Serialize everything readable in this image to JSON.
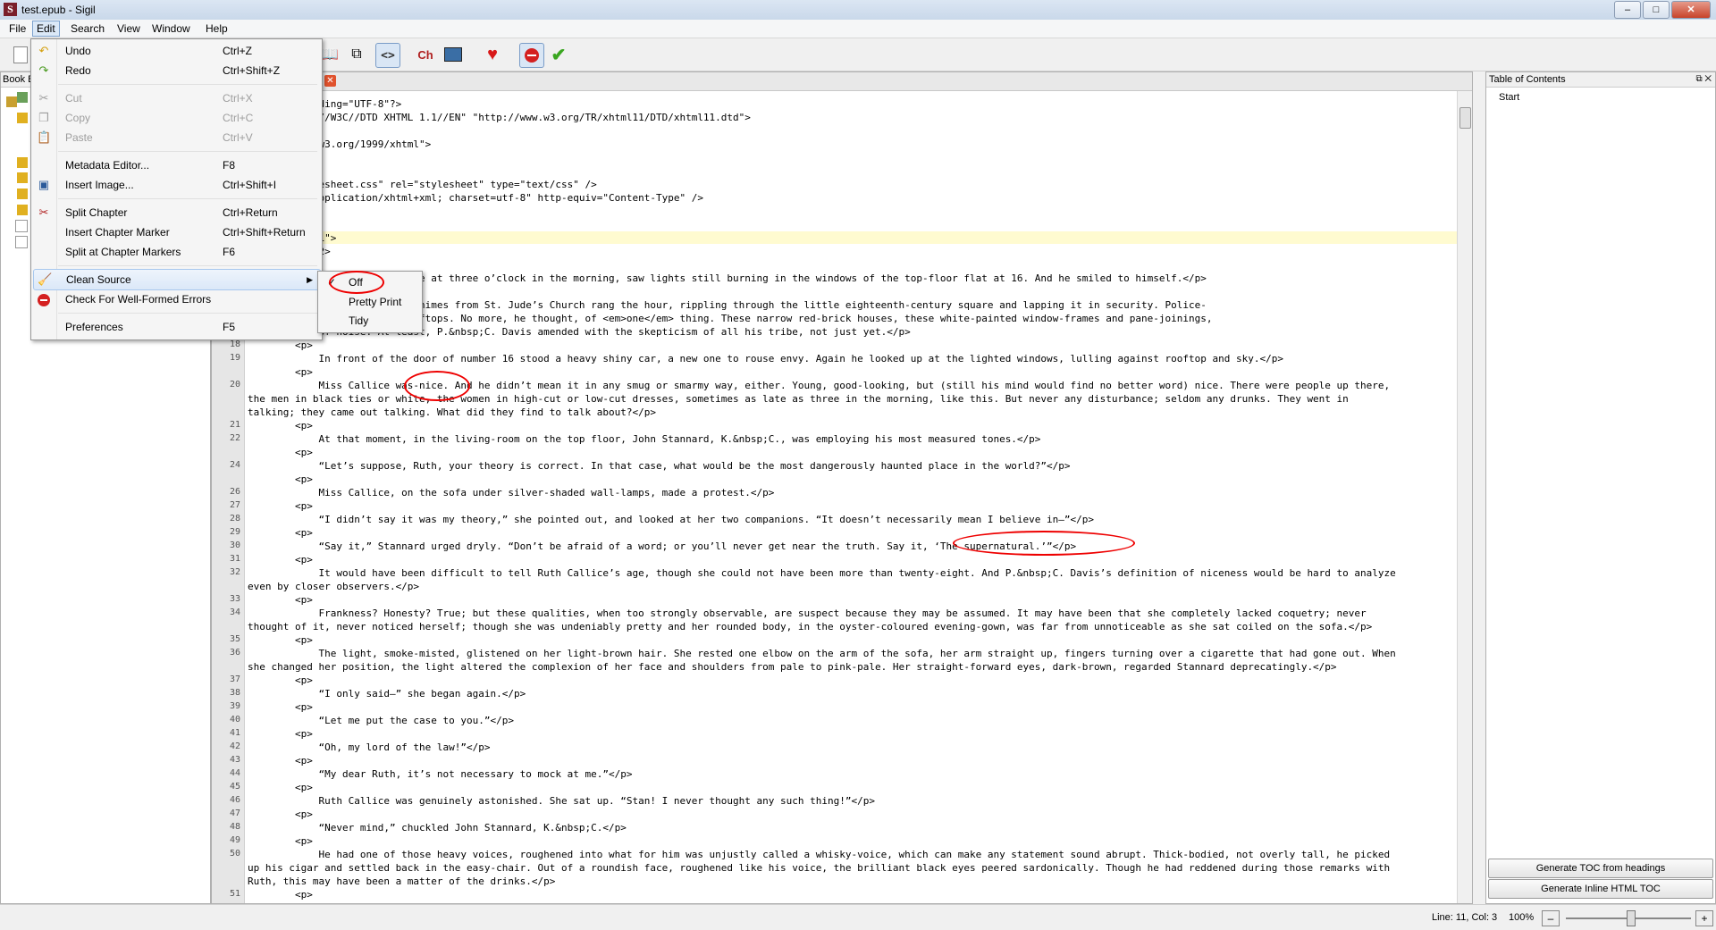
{
  "window": {
    "title": "test.epub - Sigil",
    "app_icon": "S"
  },
  "menubar": [
    "File",
    "Edit",
    "Search",
    "View",
    "Window",
    "Help"
  ],
  "edit_menu": {
    "undo": {
      "label": "Undo",
      "shortcut": "Ctrl+Z"
    },
    "redo": {
      "label": "Redo",
      "shortcut": "Ctrl+Shift+Z"
    },
    "cut": {
      "label": "Cut",
      "shortcut": "Ctrl+X"
    },
    "copy": {
      "label": "Copy",
      "shortcut": "Ctrl+C"
    },
    "paste": {
      "label": "Paste",
      "shortcut": "Ctrl+V"
    },
    "metadata": {
      "label": "Metadata Editor...",
      "shortcut": "F8"
    },
    "insert_image": {
      "label": "Insert Image...",
      "shortcut": "Ctrl+Shift+I"
    },
    "split_chapter": {
      "label": "Split Chapter",
      "shortcut": "Ctrl+Return"
    },
    "insert_marker": {
      "label": "Insert Chapter Marker",
      "shortcut": "Ctrl+Shift+Return"
    },
    "split_markers": {
      "label": "Split at Chapter Markers",
      "shortcut": "F6"
    },
    "clean_source": {
      "label": "Clean Source"
    },
    "check_errors": {
      "label": "Check For Well-Formed Errors"
    },
    "preferences": {
      "label": "Preferences",
      "shortcut": "F5"
    }
  },
  "clean_submenu": {
    "off": "Off",
    "pretty": "Pretty Print",
    "tidy": "Tidy",
    "checked": "✓"
  },
  "book_browser": {
    "title": "Book B"
  },
  "toc_panel": {
    "title": "Table of Contents",
    "items": [
      "Start"
    ],
    "btn_generate": "Generate TOC from headings",
    "btn_inline": "Generate Inline HTML TOC"
  },
  "status": {
    "position": "Line: 11, Col: 3",
    "zoom": "100%"
  },
  "code_lines": [
    {
      "n": "",
      "t": "n=\"1.0\" encoding=\"UTF-8\"?>"
    },
    {
      "n": "",
      "t": "ml PUBLIC \"-//W3C//DTD XHTML 1.1//EN\" \"http://www.w3.org/TR/xhtml11/DTD/xhtml11.dtd\">"
    },
    {
      "n": "",
      "t": ""
    },
    {
      "n": "",
      "t": "\"http://www.w3.org/1999/xhtml\">"
    },
    {
      "n": "",
      "t": ""
    },
    {
      "n": "",
      "t": "le></title>"
    },
    {
      "n": "",
      "t": "k href=\"stylesheet.css\" rel=\"stylesheet\" type=\"text/css\" />"
    },
    {
      "n": "",
      "t": "a content=\"application/xhtml+xml; charset=utf-8\" http-equiv=\"Content-Type\" />"
    },
    {
      "n": "",
      "t": ""
    },
    {
      "n": "",
      "t": ""
    },
    {
      "n": "",
      "t": "id=\"chapter01\">",
      "hl": true
    },
    {
      "n": "",
      "t": "Chapter 1</h2>"
    },
    {
      "n": "",
      "t": ""
    },
    {
      "n": "",
      "t": "assing through Moreston Square at three o’clock in the morning, saw lights still burning in the windows of the top-floor flat at 16. And he smiled to himself.</p>"
    },
    {
      "n": "",
      "t": ""
    },
    {
      "n": "",
      "t": "ss Ruth Callice’s flat. The chimes from St. Jude’s Church rang the hour, rippling through the little eighteenth-century square and lapping it in security. Police-"
    },
    {
      "n": "",
      "t": "t a quarter-moon over the rooftops. No more, he thought, of <em>one</em> thing. These narrow red-brick houses, these white-painted window-frames and pane-joinings,"
    },
    {
      "n": "",
      "t": "a nightmare of noise. At least, P.&nbsp;C. Davis amended with the skepticism of all his tribe, not just yet.</p>"
    },
    {
      "n": "18",
      "t": "        <p>"
    },
    {
      "n": "19",
      "t": "            In front of the door of number 16 stood a heavy shiny car, a new one to rouse envy. Again he looked up at the lighted windows, lulling against rooftop and sky.</p>"
    },
    {
      "n": "",
      "t": "        <p>"
    },
    {
      "n": "20",
      "t": "            Miss Callice was-nice. And he didn’t mean it in any smug or smarmy way, either. Young, good-looking, but (still his mind would find no better word) nice. There were people up there,"
    },
    {
      "n": "",
      "t": "the men in black ties or white, the women in high-cut or low-cut dresses, sometimes as late as three in the morning, like this. But never any disturbance; seldom any drunks. They went in"
    },
    {
      "n": "",
      "t": "talking; they came out talking. What did they find to talk about?</p>"
    },
    {
      "n": "21",
      "t": "        <p>"
    },
    {
      "n": "22",
      "t": "            At that moment, in the living-room on the top floor, John Stannard, K.&nbsp;C., was employing his most measured tones.</p>"
    },
    {
      "n": "",
      "t": "        <p>"
    },
    {
      "n": "24",
      "t": "            “Let’s suppose, Ruth, your theory is correct. In that case, what would be the most dangerously haunted place in the world?”</p>"
    },
    {
      "n": "",
      "t": "        <p>"
    },
    {
      "n": "26",
      "t": "            Miss Callice, on the sofa under silver-shaded wall-lamps, made a protest.</p>"
    },
    {
      "n": "27",
      "t": "        <p>"
    },
    {
      "n": "28",
      "t": "            “I didn’t say it was my theory,” she pointed out, and looked at her two companions. “It doesn’t necessarily mean I believe in—”</p>"
    },
    {
      "n": "29",
      "t": "        <p>"
    },
    {
      "n": "30",
      "t": "            “Say it,” Stannard urged dryly. “Don’t be afraid of a word; or you’ll never get near the truth. Say it, ‘The supernatural.’”</p>"
    },
    {
      "n": "31",
      "t": "        <p>"
    },
    {
      "n": "32",
      "t": "            It would have been difficult to tell Ruth Callice’s age, though she could not have been more than twenty-eight. And P.&nbsp;C. Davis’s definition of niceness would be hard to analyze"
    },
    {
      "n": "",
      "t": "even by closer observers.</p>"
    },
    {
      "n": "33",
      "t": "        <p>"
    },
    {
      "n": "34",
      "t": "            Frankness? Honesty? True; but these qualities, when too strongly observable, are suspect because they may be assumed. It may have been that she completely lacked coquetry; never"
    },
    {
      "n": "",
      "t": "thought of it, never noticed herself; though she was undeniably pretty and her rounded body, in the oyster-coloured evening-gown, was far from unnoticeable as she sat coiled on the sofa.</p>"
    },
    {
      "n": "35",
      "t": "        <p>"
    },
    {
      "n": "36",
      "t": "            The light, smoke-misted, glistened on her light-brown hair. She rested one elbow on the arm of the sofa, her arm straight up, fingers turning over a cigarette that had gone out. When"
    },
    {
      "n": "",
      "t": "she changed her position, the light altered the complexion of her face and shoulders from pale to pink-pale. Her straight-forward eyes, dark-brown, regarded Stannard deprecatingly.</p>"
    },
    {
      "n": "37",
      "t": "        <p>"
    },
    {
      "n": "38",
      "t": "            “I only said—” she began again.</p>"
    },
    {
      "n": "39",
      "t": "        <p>"
    },
    {
      "n": "40",
      "t": "            “Let me put the case to you.”</p>"
    },
    {
      "n": "41",
      "t": "        <p>"
    },
    {
      "n": "42",
      "t": "            “Oh, my lord of the law!”</p>"
    },
    {
      "n": "43",
      "t": "        <p>"
    },
    {
      "n": "44",
      "t": "            “My dear Ruth, it’s not necessary to mock at me.”</p>"
    },
    {
      "n": "45",
      "t": "        <p>"
    },
    {
      "n": "46",
      "t": "            Ruth Callice was genuinely astonished. She sat up. “Stan! I never thought any such thing!”</p>"
    },
    {
      "n": "47",
      "t": "        <p>"
    },
    {
      "n": "48",
      "t": "            “Never mind,” chuckled John Stannard, K.&nbsp;C.</p>"
    },
    {
      "n": "49",
      "t": "        <p>"
    },
    {
      "n": "50",
      "t": "            He had one of those heavy voices, roughened into what for him was unjustly called a whisky-voice, which can make any statement sound abrupt. Thick-bodied, not overly tall, he picked"
    },
    {
      "n": "",
      "t": "up his cigar and settled back in the easy-chair. Out of a roundish face, roughened like his voice, the brilliant black eyes peered sardonically. Though he had reddened during those remarks with"
    },
    {
      "n": "",
      "t": "Ruth, this may have been a matter of the drinks.</p>"
    },
    {
      "n": "51",
      "t": "        <p>"
    }
  ]
}
